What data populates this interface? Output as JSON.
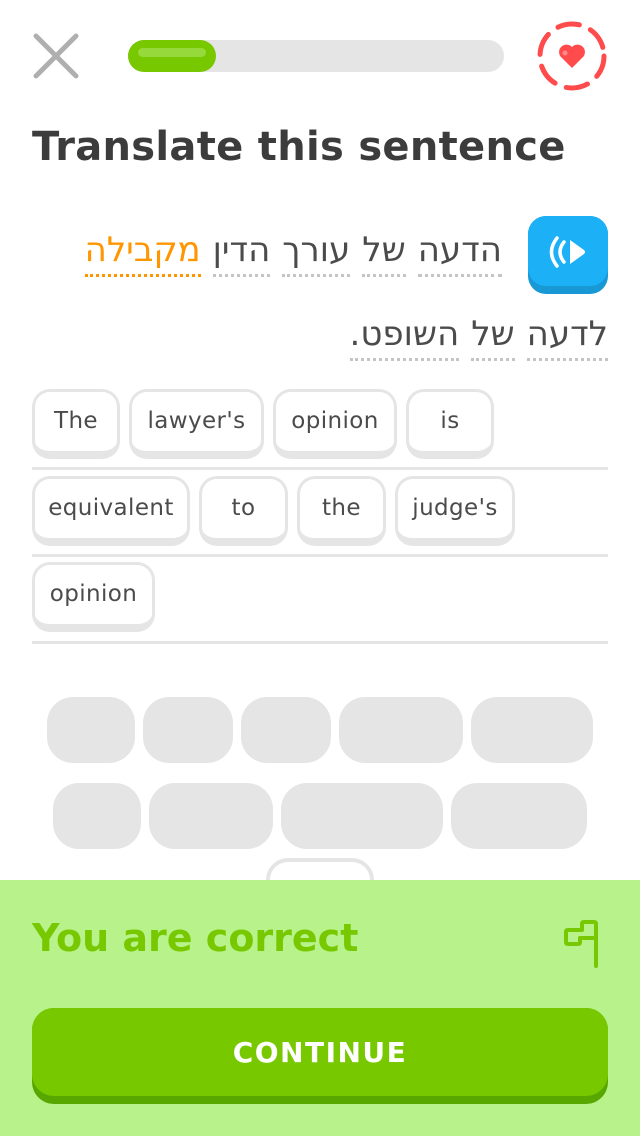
{
  "header": {
    "close_icon": "close-x-icon",
    "progress_fraction": 0.235,
    "hearts_icon": "heart-infinite-icon"
  },
  "title": "Translate this sentence",
  "prompt": {
    "speaker_icon": "speaker-icon",
    "line1_words": [
      {
        "text": "הדעה",
        "new": false
      },
      {
        "text": "של",
        "new": false
      },
      {
        "text": "עורך",
        "new": false
      },
      {
        "text": "הדין",
        "new": false
      },
      {
        "text": "מקבילה",
        "new": true
      }
    ],
    "line2_words": [
      {
        "text": "לדעה",
        "new": false
      },
      {
        "text": "של",
        "new": false
      },
      {
        "text": "השופט.",
        "new": false
      }
    ]
  },
  "answer_chips": [
    "The",
    "lawyer's",
    "opinion",
    "is",
    "equivalent",
    "to",
    "the",
    "judge's",
    "opinion"
  ],
  "colors": {
    "accent_green": "#78c800",
    "feedback_bg": "#b8f28b",
    "new_word": "#ff9600",
    "speaker_blue": "#1cb0f6",
    "heart_red": "#ff4b4b"
  },
  "footer": {
    "result": "You are correct",
    "flag_icon": "report-flag-icon",
    "continue_label": "CONTINUE"
  }
}
